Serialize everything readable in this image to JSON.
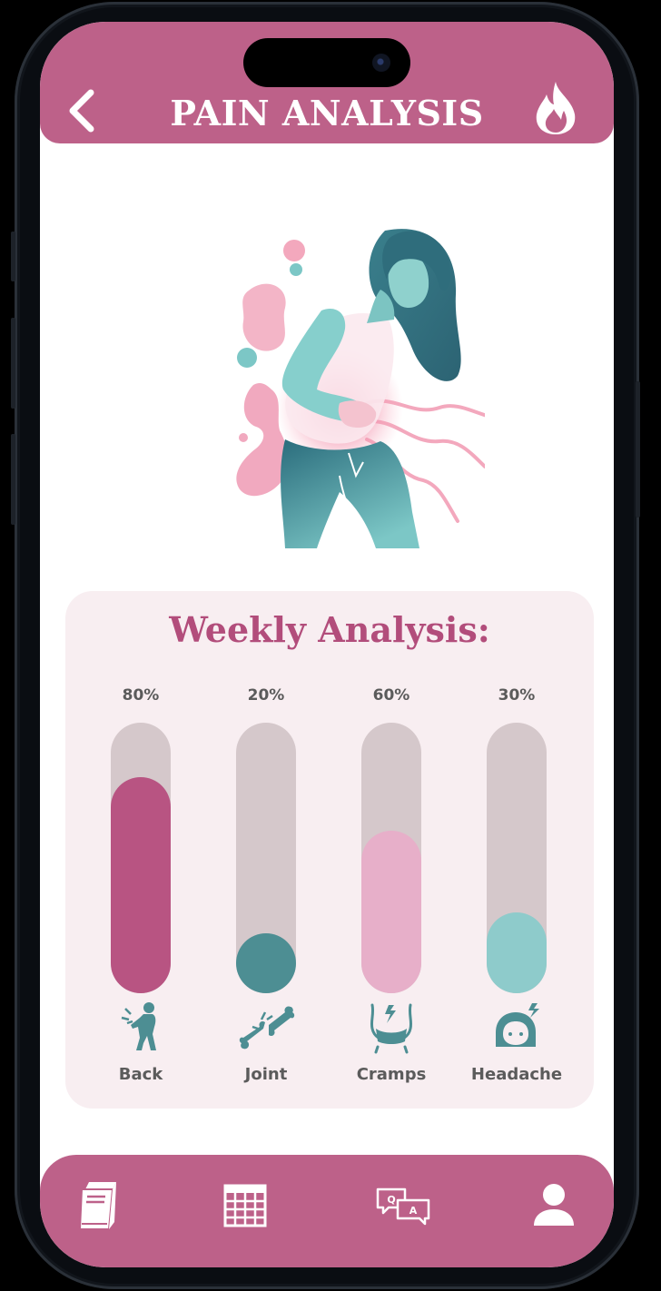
{
  "header": {
    "title": "PAIN ANALYSIS",
    "back_icon": "chevron-left-icon",
    "action_icon": "flame-icon"
  },
  "analysis": {
    "title": "Weekly Analysis:",
    "items": [
      {
        "label": "Back",
        "percent_text": "80%",
        "value": 80,
        "color": "#b85482",
        "icon": "back-pain-icon"
      },
      {
        "label": "Joint",
        "percent_text": "20%",
        "value": 20,
        "color": "#4d8e93",
        "icon": "bone-joint-icon"
      },
      {
        "label": "Cramps",
        "percent_text": "60%",
        "value": 60,
        "color": "#e7afc9",
        "icon": "abdominal-cramps-icon"
      },
      {
        "label": "Headache",
        "percent_text": "30%",
        "value": 30,
        "color": "#8ecbcb",
        "icon": "headache-face-icon"
      }
    ]
  },
  "nav": {
    "items": [
      "journal-book-icon",
      "calendar-grid-icon",
      "qa-chat-icon",
      "profile-icon"
    ]
  },
  "colors": {
    "primary": "#bd6189",
    "accent_text": "#b24d7b",
    "card_bg": "#f8eef1",
    "track": "#d5c8cb"
  }
}
